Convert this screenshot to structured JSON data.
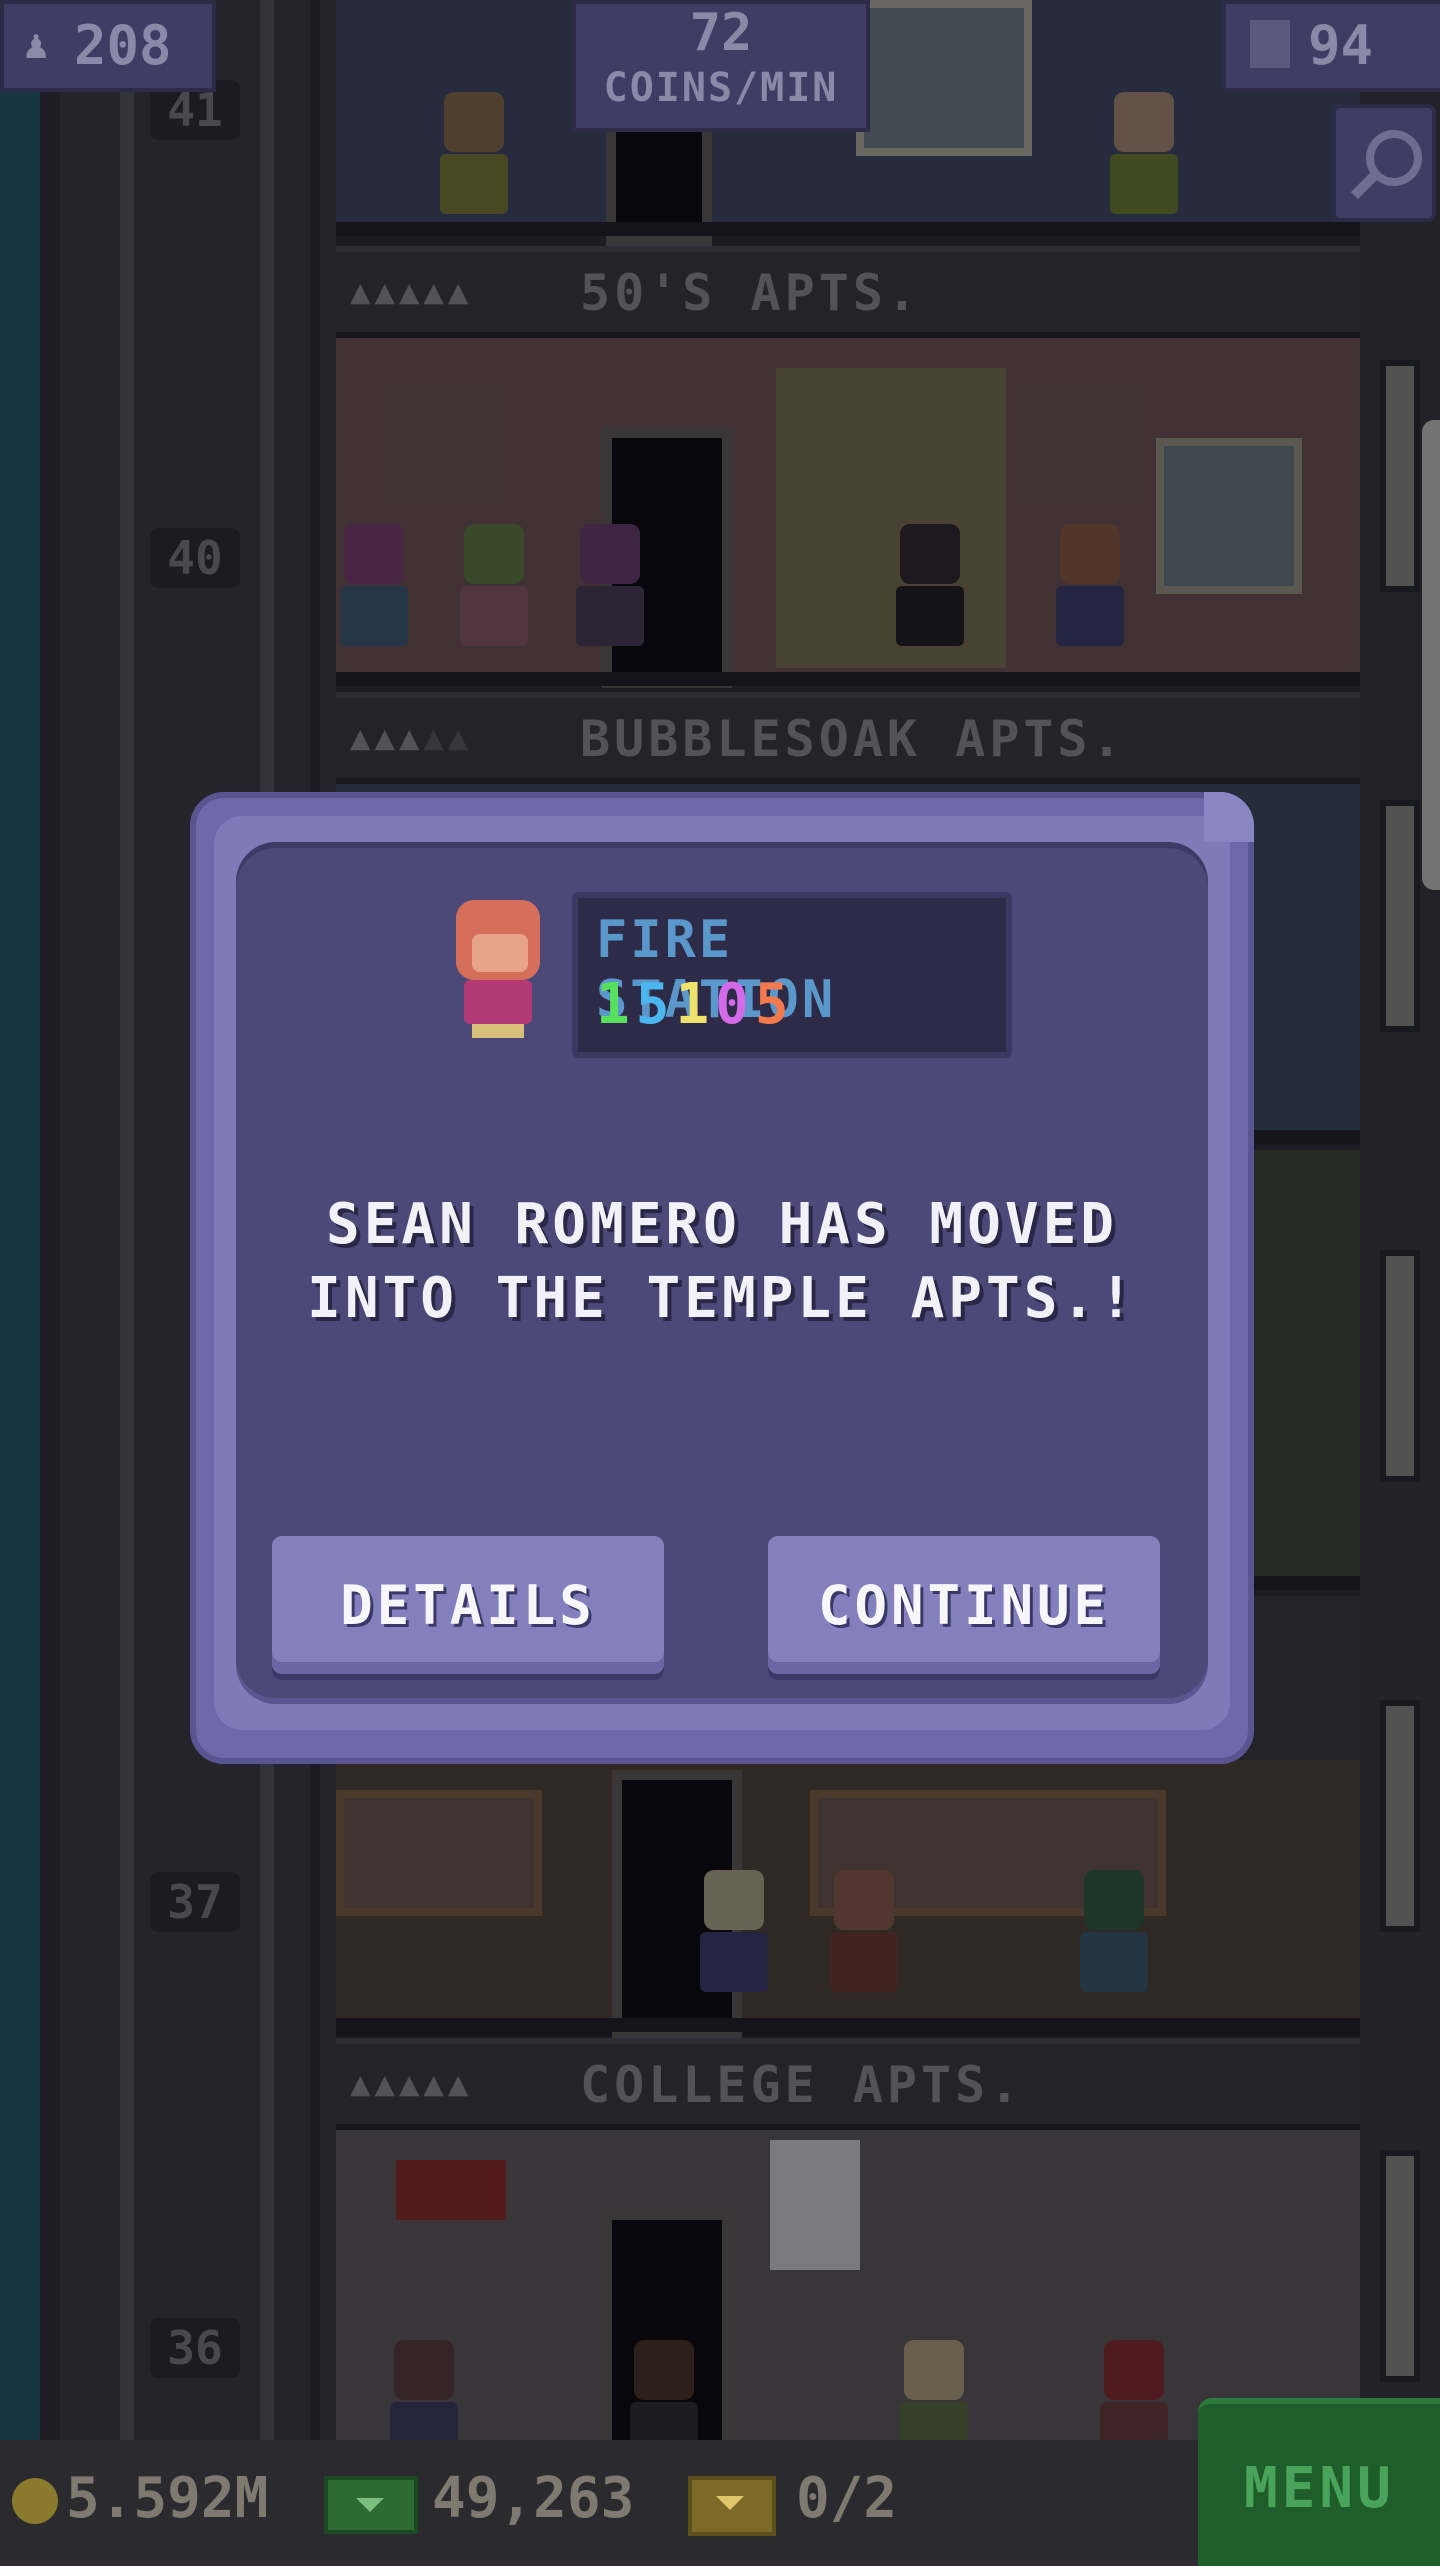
{
  "hud": {
    "population": "208",
    "coins_per_min_value": "72",
    "coins_per_min_label": "COINS/MIN",
    "floors": "94"
  },
  "tower": {
    "floor_numbers": [
      "41",
      "40",
      "37",
      "36"
    ],
    "floor_names": [
      "50'S APTS.",
      "BUBBLESOAK APTS.",
      "COLLEGE APTS."
    ]
  },
  "dialog": {
    "badge_name": "FIRE STATION",
    "badge_number_digits": [
      "1",
      "5",
      "1",
      "0",
      "5"
    ],
    "message_line1": "SEAN ROMERO HAS MOVED",
    "message_line2": "INTO THE TEMPLE APTS.!",
    "details_label": "DETAILS",
    "continue_label": "CONTINUE"
  },
  "bottom": {
    "coins": "5.592M",
    "bux": "49,263",
    "tickets": "0/2",
    "menu_label": "MENU"
  },
  "icons": [
    "person-icon",
    "floor-icon",
    "search-icon",
    "coin-icon",
    "bux-icon",
    "ticket-icon"
  ]
}
